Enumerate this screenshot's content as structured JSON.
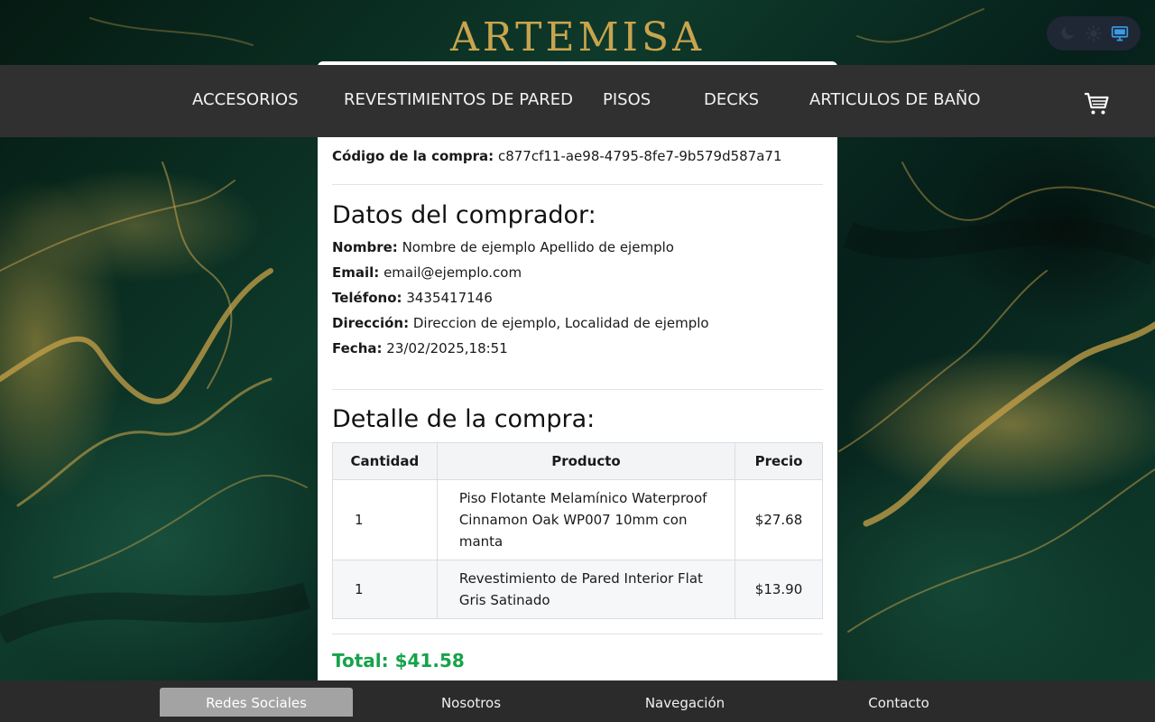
{
  "brand": "ARTEMISA",
  "theme_switch": {
    "options": [
      "moon-icon",
      "sun-icon",
      "monitor-icon"
    ],
    "selected": "monitor-icon"
  },
  "nav": {
    "items": [
      {
        "label": "ACCESORIOS"
      },
      {
        "label": "REVESTIMIENTOS DE PARED"
      },
      {
        "label": "PISOS"
      },
      {
        "label": "DECKS"
      },
      {
        "label": "ARTICULOS DE BAÑO"
      }
    ],
    "cart_icon": "cart-icon"
  },
  "purchase": {
    "code_label": "Código de la compra:",
    "code_value": "c877cf11-ae98-4795-8fe7-9b579d587a71"
  },
  "buyer": {
    "title": "Datos del comprador:",
    "fields": [
      {
        "label": "Nombre:",
        "value": "Nombre de ejemplo Apellido de ejemplo"
      },
      {
        "label": "Email:",
        "value": "email@ejemplo.com"
      },
      {
        "label": "Teléfono:",
        "value": "3435417146"
      },
      {
        "label": "Dirección:",
        "value": "Direccion de ejemplo, Localidad de ejemplo"
      },
      {
        "label": "Fecha:",
        "value": "23/02/2025,18:51"
      }
    ]
  },
  "detail": {
    "title": "Detalle de la compra:",
    "columns": [
      "Cantidad",
      "Producto",
      "Precio"
    ],
    "rows": [
      {
        "qty": "1",
        "product": "Piso Flotante Melamínico Waterproof Cinnamon Oak WP007 10mm con manta",
        "price": "$27.68"
      },
      {
        "qty": "1",
        "product": "Revestimiento de Pared Interior Flat Gris Satinado",
        "price": "$13.90"
      }
    ],
    "total": "Total: $41.58"
  },
  "footer": {
    "tabs": [
      {
        "label": "Redes Sociales",
        "active": true
      },
      {
        "label": "Nosotros",
        "active": false
      },
      {
        "label": "Navegación",
        "active": false
      },
      {
        "label": "Contacto",
        "active": false
      }
    ]
  },
  "colors": {
    "brand_gold": "#c9a44e",
    "navbar": "#303030",
    "total_green": "#16a34a",
    "active_theme": "#3b9be8"
  }
}
